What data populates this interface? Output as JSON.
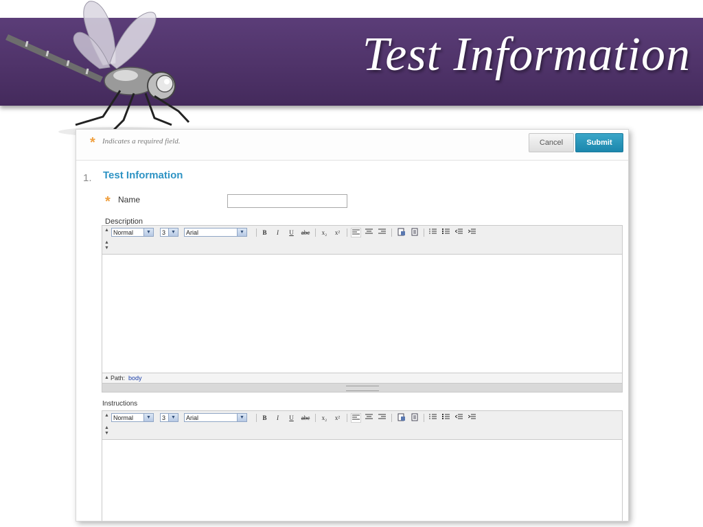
{
  "slide": {
    "title": "Test Information"
  },
  "form": {
    "required_note": "Indicates a required field.",
    "required_marker": "*",
    "cancel_label": "Cancel",
    "submit_label": "Submit",
    "section_number": "1.",
    "section_title": "Test Information",
    "name_label": "Name",
    "name_value": "",
    "description_label": "Description",
    "instructions_label": "Instructions"
  },
  "editor": {
    "format_value": "Normal",
    "size_value": "3",
    "font_value": "Arial",
    "bold": "B",
    "italic": "I",
    "underline": "U",
    "strike": "abc",
    "subscript": "x₂",
    "superscript": "x²",
    "path_label": "Path:",
    "path_value": "body"
  },
  "colors": {
    "title_band": "#4f3369",
    "accent_blue": "#2e93c4",
    "submit_button": "#1b86ac",
    "required_star": "#f0a040"
  },
  "icons": [
    "dragonfly-logo",
    "align-left-icon",
    "align-center-icon",
    "align-right-icon",
    "paste-word-icon",
    "paste-text-icon",
    "numbered-list-icon",
    "bullet-list-icon",
    "outdent-icon",
    "indent-icon"
  ]
}
